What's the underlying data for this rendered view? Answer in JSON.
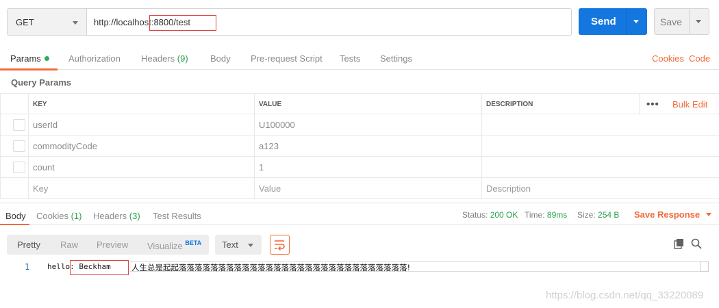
{
  "request": {
    "method": "GET",
    "url": "http://localhost:8800/test",
    "send_label": "Send",
    "save_label": "Save"
  },
  "request_tabs": {
    "params": "Params",
    "authorization": "Authorization",
    "headers": "Headers",
    "headers_count": "(9)",
    "body": "Body",
    "prerequest": "Pre-request Script",
    "tests": "Tests",
    "settings": "Settings",
    "cookies": "Cookies",
    "code": "Code"
  },
  "query_params": {
    "title": "Query Params",
    "columns": {
      "key": "KEY",
      "value": "VALUE",
      "description": "DESCRIPTION"
    },
    "bulk_edit": "Bulk Edit",
    "rows": [
      {
        "key": "userId",
        "value": "U100000",
        "description": ""
      },
      {
        "key": "commodityCode",
        "value": "a123",
        "description": ""
      },
      {
        "key": "count",
        "value": "1",
        "description": ""
      }
    ],
    "placeholders": {
      "key": "Key",
      "value": "Value",
      "description": "Description"
    }
  },
  "response_tabs": {
    "body": "Body",
    "cookies": "Cookies",
    "cookies_count": "(1)",
    "headers": "Headers",
    "headers_count": "(3)",
    "test_results": "Test Results"
  },
  "response_status": {
    "status_label": "Status:",
    "status_value": "200 OK",
    "time_label": "Time:",
    "time_value": "89ms",
    "size_label": "Size:",
    "size_value": "254 B",
    "save_response": "Save Response"
  },
  "viewer": {
    "pretty": "Pretty",
    "raw": "Raw",
    "preview": "Preview",
    "visualize": "Visualize",
    "beta": "BETA",
    "format": "Text"
  },
  "response_body": {
    "line_number": "1",
    "text_prefix": "hello: Beckham",
    "text_rest": "人生总是起起落落落落落落落落落落落落落落落落落落落落落落落落落落落落落!"
  },
  "watermark": "https://blog.csdn.net/qq_33220089",
  "colors": {
    "accent": "#f26b3a",
    "primary": "#1477e0",
    "success": "#27a04a",
    "highlight": "#e04040"
  }
}
